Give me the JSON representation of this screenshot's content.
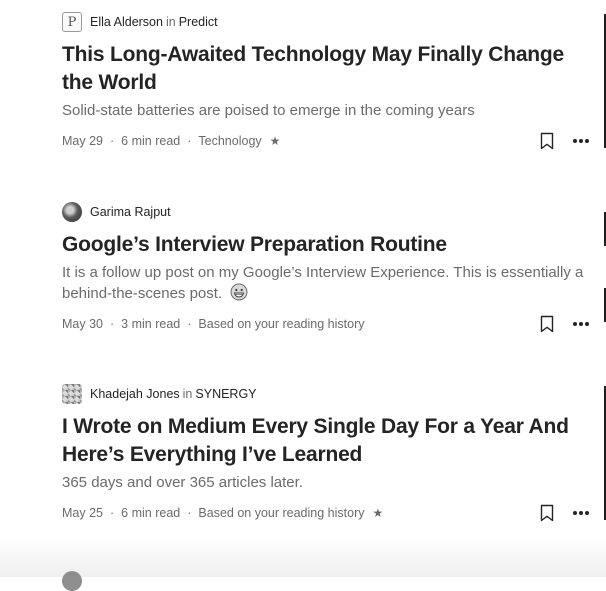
{
  "articles": [
    {
      "author": "Ella Alderson",
      "in_word": "in",
      "publication": "Predict",
      "avatar_letter": "P",
      "title": "This Long-Awaited Technology May Finally Change the World",
      "subtitle": "Solid-state batteries are poised to emerge in the coming years",
      "date": "May 29",
      "read_time": "6 min read",
      "tag": "Technology",
      "starred": true
    },
    {
      "author": "Garima Rajput",
      "title": "Google’s Interview Preparation Routine",
      "subtitle": "It is a follow up post on my Google’s Interview Experience. This is essentially a behind-the-scenes post.",
      "date": "May 30",
      "read_time": "3 min read",
      "tag": "Based on your reading history",
      "starred": false
    },
    {
      "author": "Khadejah Jones",
      "in_word": "in",
      "publication": "SYNERGY",
      "title": "I Wrote on Medium Every Single Day For a Year And Here’s Everything I’ve Learned",
      "subtitle": "365 days and over 365 articles later.",
      "date": "May 25",
      "read_time": "6 min read",
      "tag": "Based on your reading history",
      "starred": true
    }
  ],
  "separator": "·",
  "star_glyph": "★",
  "colors": {
    "text": "#242424",
    "muted": "#6b6b6b"
  },
  "icons": {
    "bookmark": "bookmark-icon",
    "more": "more-options-icon",
    "emoji": "grinning-face-icon"
  }
}
